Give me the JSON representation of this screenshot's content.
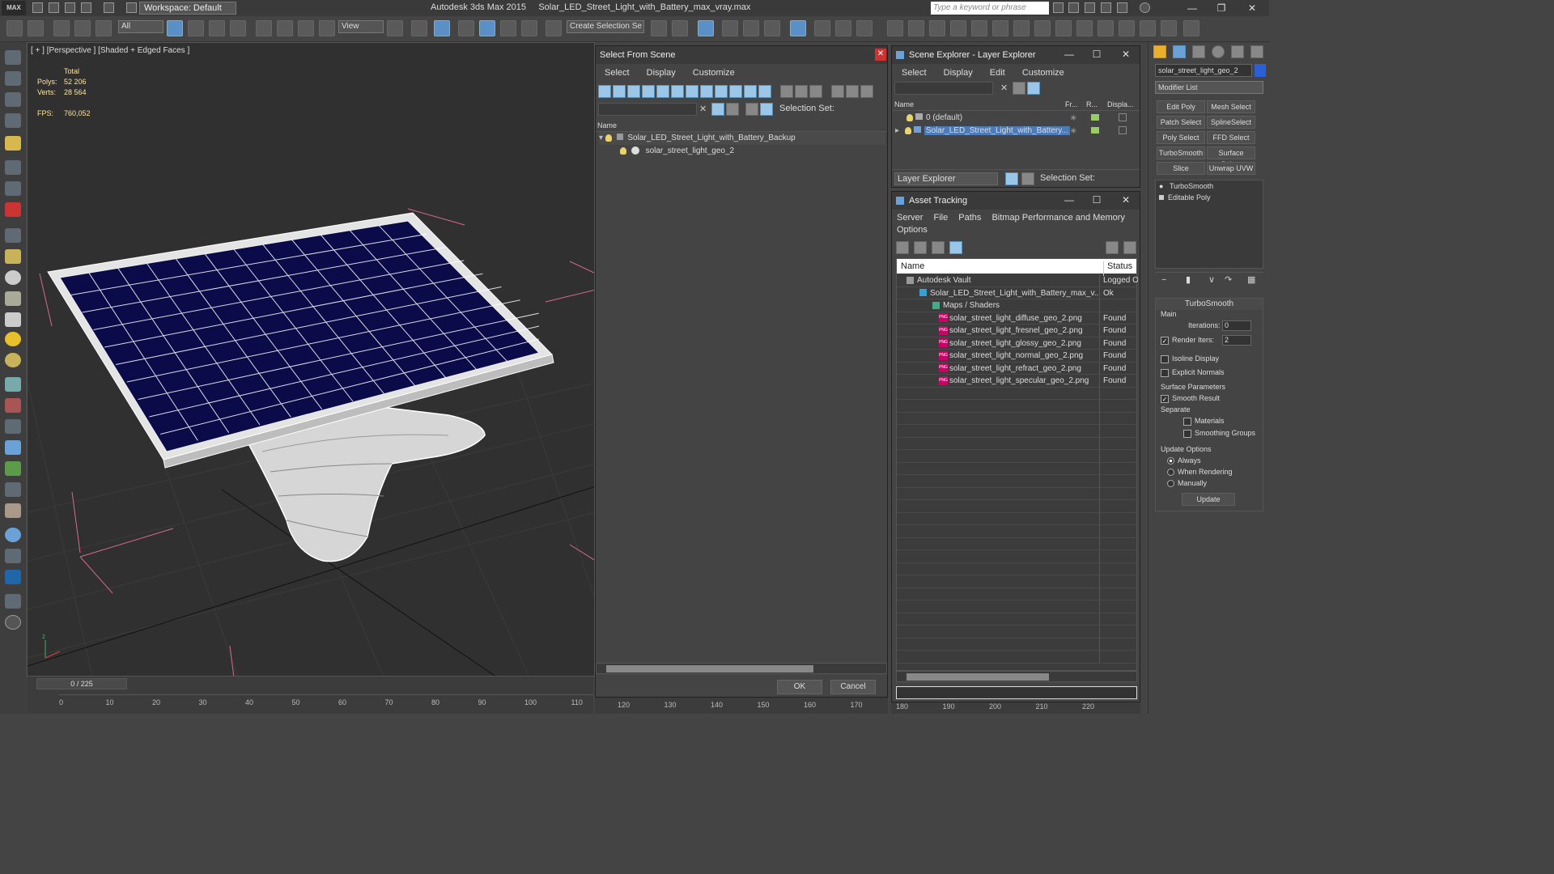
{
  "titlebar": {
    "app_title": "Autodesk 3ds Max  2015",
    "file_title": "Solar_LED_Street_Light_with_Battery_max_vray.max",
    "logo": "MAX",
    "workspace": "Workspace: Default",
    "search_placeholder": "Type a keyword or phrase"
  },
  "toolbar": {
    "selection_filter": "All",
    "ref_coord": "View",
    "selection_set": "Create Selection Se"
  },
  "viewport": {
    "label": "[ + ] [Perspective ] [Shaded + Edged Faces ]",
    "total_label": "Total",
    "polys_label": "Polys:",
    "polys_value": "52 206",
    "verts_label": "Verts:",
    "verts_value": "28 564",
    "fps_label": "FPS:",
    "fps_value": "760,052"
  },
  "timeline": {
    "frame_display": "0 / 225",
    "ticks": [
      "0",
      "10",
      "20",
      "30",
      "40",
      "50",
      "60",
      "70",
      "80",
      "90",
      "100",
      "110"
    ]
  },
  "select_from_scene": {
    "title": "Select From Scene",
    "menu": [
      "Select",
      "Display",
      "Customize"
    ],
    "selection_set_label": "Selection Set:",
    "column_name": "Name",
    "tree": [
      {
        "label": "Solar_LED_Street_Light_with_Battery_Backup"
      },
      {
        "label": "solar_street_light_geo_2"
      }
    ],
    "ok": "OK",
    "cancel": "Cancel",
    "ruler_ticks": [
      "120",
      "130",
      "140",
      "150",
      "160",
      "170"
    ]
  },
  "scene_explorer": {
    "title": "Scene Explorer - Layer Explorer",
    "menu": [
      "Select",
      "Display",
      "Edit",
      "Customize"
    ],
    "columns": [
      "Name",
      "Fr...",
      "R...",
      "Displa..."
    ],
    "layers": [
      {
        "label": "0 (default)"
      },
      {
        "label": "Solar_LED_Street_Light_with_Battery..."
      }
    ],
    "footer_dropdown": "Layer Explorer",
    "selection_set_label": "Selection Set:"
  },
  "asset_tracking": {
    "title": "Asset Tracking",
    "menu": [
      "Server",
      "File",
      "Paths",
      "Bitmap Performance and Memory",
      "Options"
    ],
    "columns": [
      "Name",
      "Status"
    ],
    "rows": [
      {
        "name": "Autodesk Vault",
        "status": "Logged O"
      },
      {
        "name": "Solar_LED_Street_Light_with_Battery_max_v...",
        "status": "Ok"
      },
      {
        "name": "Maps / Shaders",
        "status": ""
      },
      {
        "name": "solar_street_light_diffuse_geo_2.png",
        "status": "Found"
      },
      {
        "name": "solar_street_light_fresnel_geo_2.png",
        "status": "Found"
      },
      {
        "name": "solar_street_light_glossy_geo_2.png",
        "status": "Found"
      },
      {
        "name": "solar_street_light_normal_geo_2.png",
        "status": "Found"
      },
      {
        "name": "solar_street_light_refract_geo_2.png",
        "status": "Found"
      },
      {
        "name": "solar_street_light_specular_geo_2.png",
        "status": "Found"
      }
    ],
    "ruler_ticks": [
      "180",
      "190",
      "200",
      "210",
      "220"
    ]
  },
  "command_panel": {
    "object_name": "solar_street_light_geo_2",
    "modifier_list": "Modifier List",
    "mod_buttons": [
      "Edit Poly",
      "Mesh Select",
      "Patch Select",
      "SplineSelect",
      "Poly Select",
      "FFD Select",
      "TurboSmooth",
      "Surface Select",
      "Slice",
      "Unwrap UVW"
    ],
    "stack": [
      "TurboSmooth",
      "Editable Poly"
    ],
    "rollout_title": "TurboSmooth",
    "main_label": "Main",
    "iterations_label": "Iterations:",
    "iterations_value": "0",
    "render_iters_label": "Render Iters:",
    "render_iters_value": "2",
    "isoline_label": "Isoline Display",
    "explicit_label": "Explicit Normals",
    "surface_params": "Surface Parameters",
    "smooth_result": "Smooth Result",
    "separate_label": "Separate",
    "materials_label": "Materials",
    "smoothing_label": "Smoothing Groups",
    "update_options": "Update Options",
    "always": "Always",
    "when_rendering": "When Rendering",
    "manually": "Manually",
    "update_btn": "Update"
  },
  "colors": {
    "accent": "#5b8fc7",
    "panel_blue": "#0b0b4a",
    "selected_row": "#4c7bb8"
  }
}
